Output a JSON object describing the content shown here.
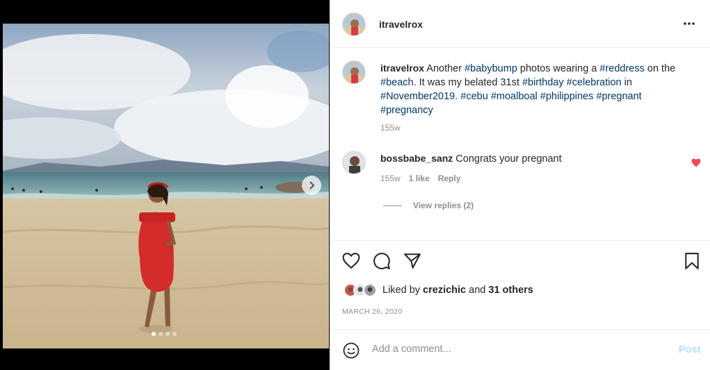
{
  "post": {
    "author": "itravelrox",
    "caption_parts": [
      {
        "text": "Another ",
        "tag": false
      },
      {
        "text": "#babybump",
        "tag": true
      },
      {
        "text": " photos wearing a ",
        "tag": false
      },
      {
        "text": "#reddress",
        "tag": true
      },
      {
        "text": " on the ",
        "tag": false
      },
      {
        "text": "#beach",
        "tag": true
      },
      {
        "text": ". It was my belated 31st ",
        "tag": false
      },
      {
        "text": "#birthday",
        "tag": true
      },
      {
        "text": " ",
        "tag": false
      },
      {
        "text": "#celebration",
        "tag": true
      },
      {
        "text": " in ",
        "tag": false
      },
      {
        "text": "#November2019",
        "tag": true
      },
      {
        "text": ". ",
        "tag": false
      },
      {
        "text": "#cebu",
        "tag": true
      },
      {
        "text": " ",
        "tag": false
      },
      {
        "text": "#moalboal",
        "tag": true
      },
      {
        "text": " ",
        "tag": false
      },
      {
        "text": "#philippines",
        "tag": true
      },
      {
        "text": " ",
        "tag": false
      },
      {
        "text": "#pregnant",
        "tag": true
      },
      {
        "text": " ",
        "tag": false
      },
      {
        "text": "#pregnancy",
        "tag": true
      }
    ],
    "caption_age": "155w",
    "date": "MARCH 26, 2020"
  },
  "media": {
    "slide_count": 4,
    "active_slide": 1,
    "next_icon": "chevron-right-icon"
  },
  "comment": {
    "author": "bossbabe_sanz",
    "text": "Congrats your pregnant",
    "age": "155w",
    "likes": "1 like",
    "reply_label": "Reply",
    "view_replies": "View replies (2)",
    "liked": true
  },
  "likes": {
    "prefix": "Liked by ",
    "user": "crezichic",
    "middle": " and ",
    "others": "31 others"
  },
  "actions": {
    "like_icon": "heart-icon",
    "comment_icon": "comment-bubble-icon",
    "share_icon": "paper-plane-icon",
    "save_icon": "bookmark-icon",
    "more_icon": "more-horizontal-icon"
  },
  "comment_box": {
    "placeholder": "Add a comment...",
    "post_label": "Post",
    "emoji_icon": "smiley-icon"
  },
  "colors": {
    "hashtag": "#00376b",
    "heart_liked": "#ed4956",
    "post_disabled": "#b2dffc",
    "meta": "#8e8e8e"
  }
}
